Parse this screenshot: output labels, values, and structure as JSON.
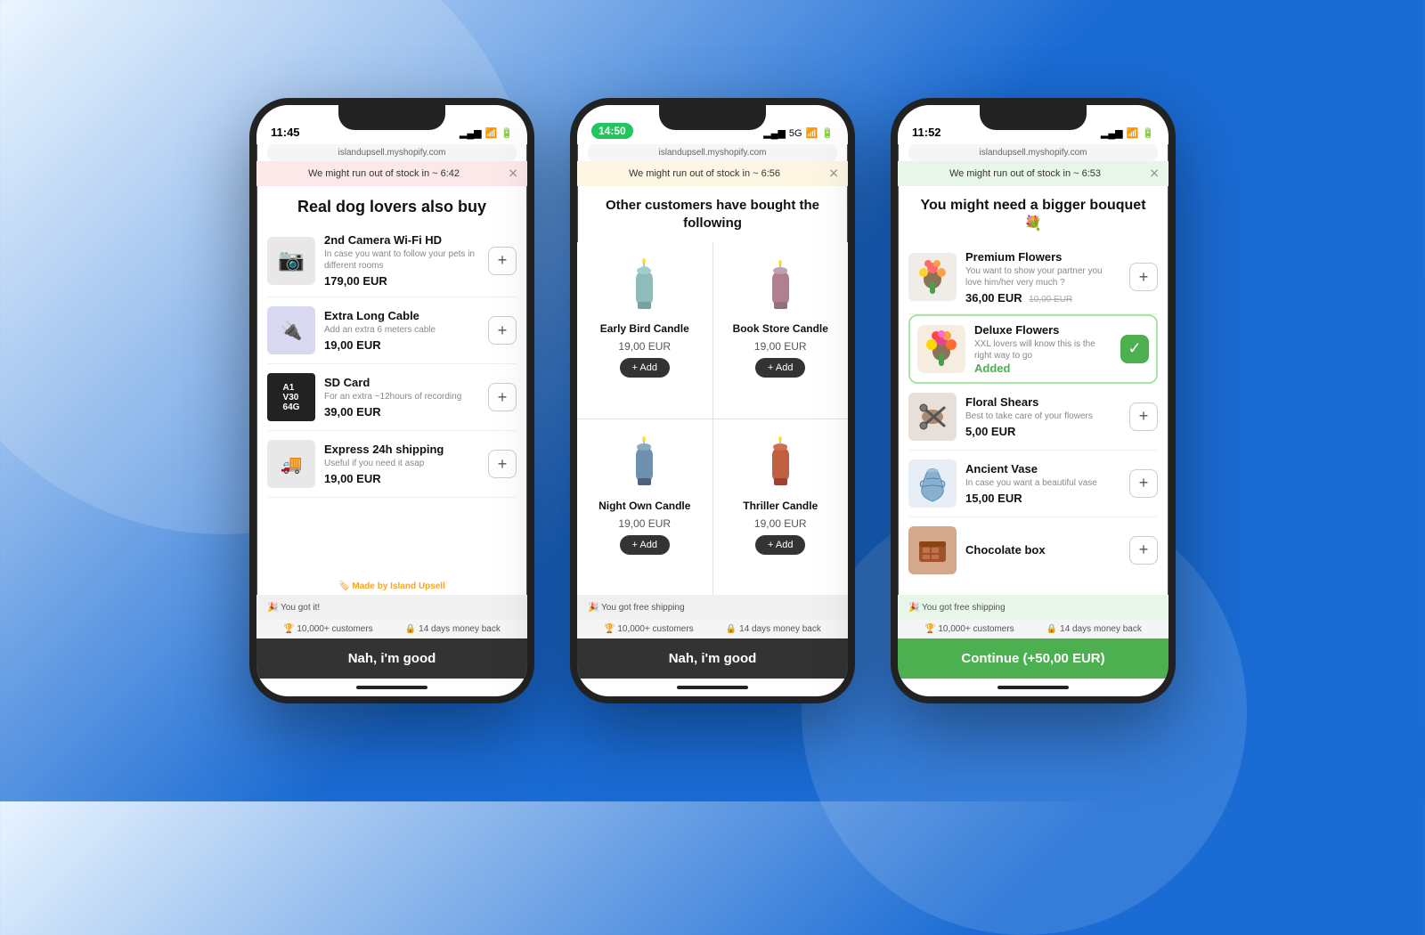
{
  "background": {
    "color_left": "#e8f4ff",
    "color_right": "#1a6bd4"
  },
  "phones": [
    {
      "id": "phone1",
      "status_bar": {
        "time": "11:45",
        "time_style": "plain",
        "signal": "▂▄▆",
        "wifi": "wifi",
        "battery": "🔋",
        "extra": "✈"
      },
      "url": "islandupsell.myshopify.com",
      "alert": {
        "text": "We might run out of stock in ~ 6:42",
        "style": "pink"
      },
      "title": "Real dog lovers also buy",
      "products": [
        {
          "name": "2nd Camera Wi-Fi HD",
          "desc": "In case you want to follow your pets in different rooms",
          "price": "179,00 EUR",
          "icon": "📷",
          "icon_style": "img-camera"
        },
        {
          "name": "Extra Long Cable",
          "desc": "Add an extra 6 meters cable",
          "price": "19,00 EUR",
          "icon": "🔌",
          "icon_style": "img-cable"
        },
        {
          "name": "SD Card",
          "desc": "For an extra ~12hours of recording",
          "price": "39,00 EUR",
          "icon": "💾",
          "icon_style": "img-sdcard"
        },
        {
          "name": "Express 24h shipping",
          "desc": "Useful if you need it asap",
          "price": "19,00 EUR",
          "icon": "🚚",
          "icon_style": "img-truck"
        }
      ],
      "made_by": "Made by",
      "made_by_brand": "Island Upsell",
      "progress_text": "🎉 You got it!",
      "trust_items": [
        "🏆 10,000+ customers",
        "🔒 14 days money back"
      ],
      "cta": "Nah, i'm good",
      "cta_style": "dark"
    },
    {
      "id": "phone2",
      "status_bar": {
        "time": "14:50",
        "time_style": "green-pill",
        "signal": "▂▄▆",
        "wifi": "wifi",
        "battery": "🔋",
        "extra": "5G"
      },
      "url": "islandupsell.myshopify.com",
      "alert": {
        "text": "We might run out of stock in ~ 6:56",
        "style": "yellow"
      },
      "title": "Other customers have bought the following",
      "grid_products": [
        {
          "name": "Early Bird Candle",
          "price": "19,00 EUR",
          "icon": "🕯️",
          "color": "#8fbcbb"
        },
        {
          "name": "Book Store Candle",
          "price": "19,00 EUR",
          "icon": "🕯️",
          "color": "#b08090"
        },
        {
          "name": "Night Own Candle",
          "price": "19,00 EUR",
          "icon": "🕯️",
          "color": "#7090b0"
        },
        {
          "name": "Thriller Candle",
          "price": "19,00 EUR",
          "icon": "🕯️",
          "color": "#c06040"
        }
      ],
      "progress_text": "🎉 You got free shipping",
      "trust_items": [
        "🏆 10,000+ customers",
        "🔒 14 days money back"
      ],
      "cta": "Nah, i'm good",
      "cta_style": "dark"
    },
    {
      "id": "phone3",
      "status_bar": {
        "time": "11:52",
        "time_style": "plain",
        "signal": "▂▄▆",
        "wifi": "wifi",
        "battery": "🔋",
        "extra": "✈"
      },
      "url": "islandupsell.myshopify.com",
      "alert": {
        "text": "We might run out of stock in ~ 6:53",
        "style": "green-light"
      },
      "title": "You might need a bigger bouquet 💐",
      "products": [
        {
          "name": "Premium Flowers",
          "desc": "You want to show your partner you love him/her very much ?",
          "price": "36,00 EUR",
          "old_price": "10,00 EUR",
          "icon": "💐",
          "icon_style": "img-flowers",
          "added": false
        },
        {
          "name": "Deluxe Flowers",
          "desc": "XXL lovers will know this is the right way to go",
          "price": "",
          "added_label": "Added",
          "icon": "🌸",
          "icon_style": "img-deluxe",
          "added": true
        },
        {
          "name": "Floral Shears",
          "desc": "Best to take care of your flowers",
          "price": "5,00 EUR",
          "icon": "✂️",
          "icon_style": "img-shears",
          "added": false
        },
        {
          "name": "Ancient Vase",
          "desc": "In case you want a beautiful vase",
          "price": "15,00 EUR",
          "icon": "🏺",
          "icon_style": "img-vase",
          "added": false
        },
        {
          "name": "Chocolate box",
          "desc": "",
          "price": "",
          "icon": "🍫",
          "icon_style": "img-choc",
          "added": false
        }
      ],
      "progress_text": "🎉 You got free shipping",
      "trust_items": [
        "🏆 10,000+ customers",
        "🔒 14 days money back"
      ],
      "cta": "Continue (+50,00 EUR)",
      "cta_style": "green"
    }
  ]
}
